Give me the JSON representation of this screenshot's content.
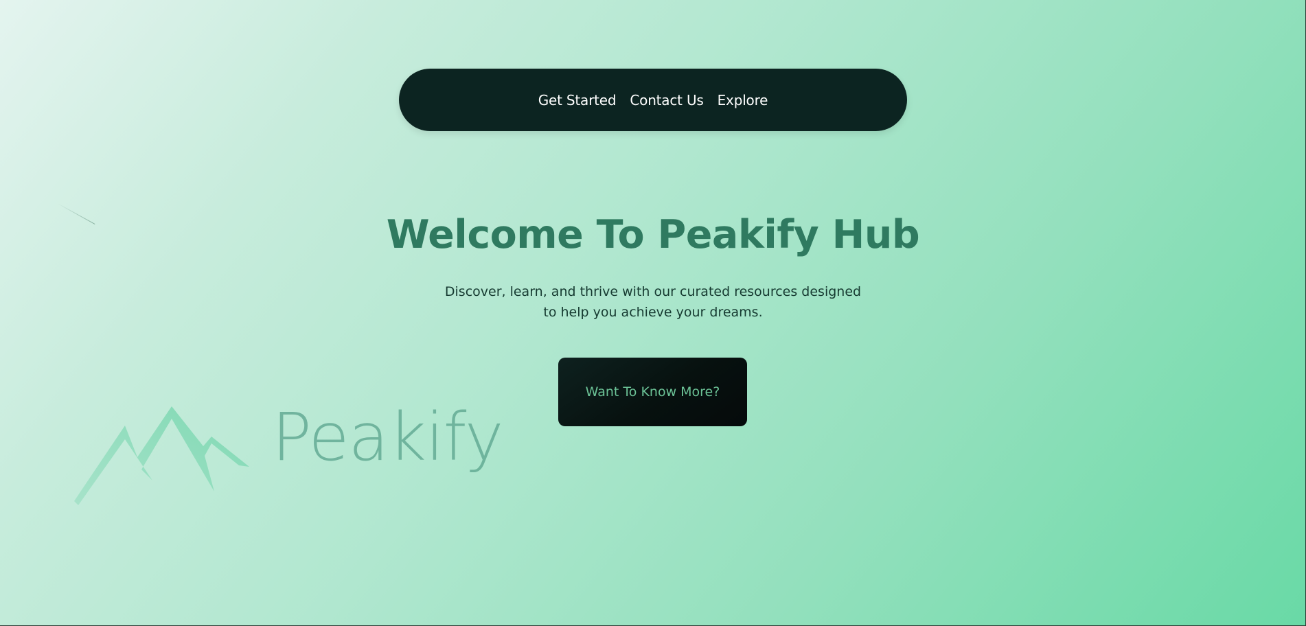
{
  "nav": {
    "links": [
      {
        "label": "Get Started"
      },
      {
        "label": "Contact Us"
      },
      {
        "label": "Explore"
      }
    ]
  },
  "hero": {
    "title": "Welcome To Peakify Hub",
    "subtitle_line1": "Discover, learn, and thrive with our curated resources designed",
    "subtitle_line2": "to help you achieve your dreams.",
    "cta_label": "Want To Know More?"
  },
  "logo": {
    "icon": "mountain-peaks-icon",
    "wordmark": "Peakify"
  },
  "colors": {
    "navbar_bg": "#0c2421",
    "title": "#2f7a60",
    "cta_bg": "#07110f",
    "cta_text": "#6cc397",
    "background_start": "#e4f4ef",
    "background_end": "#69d9a6"
  }
}
